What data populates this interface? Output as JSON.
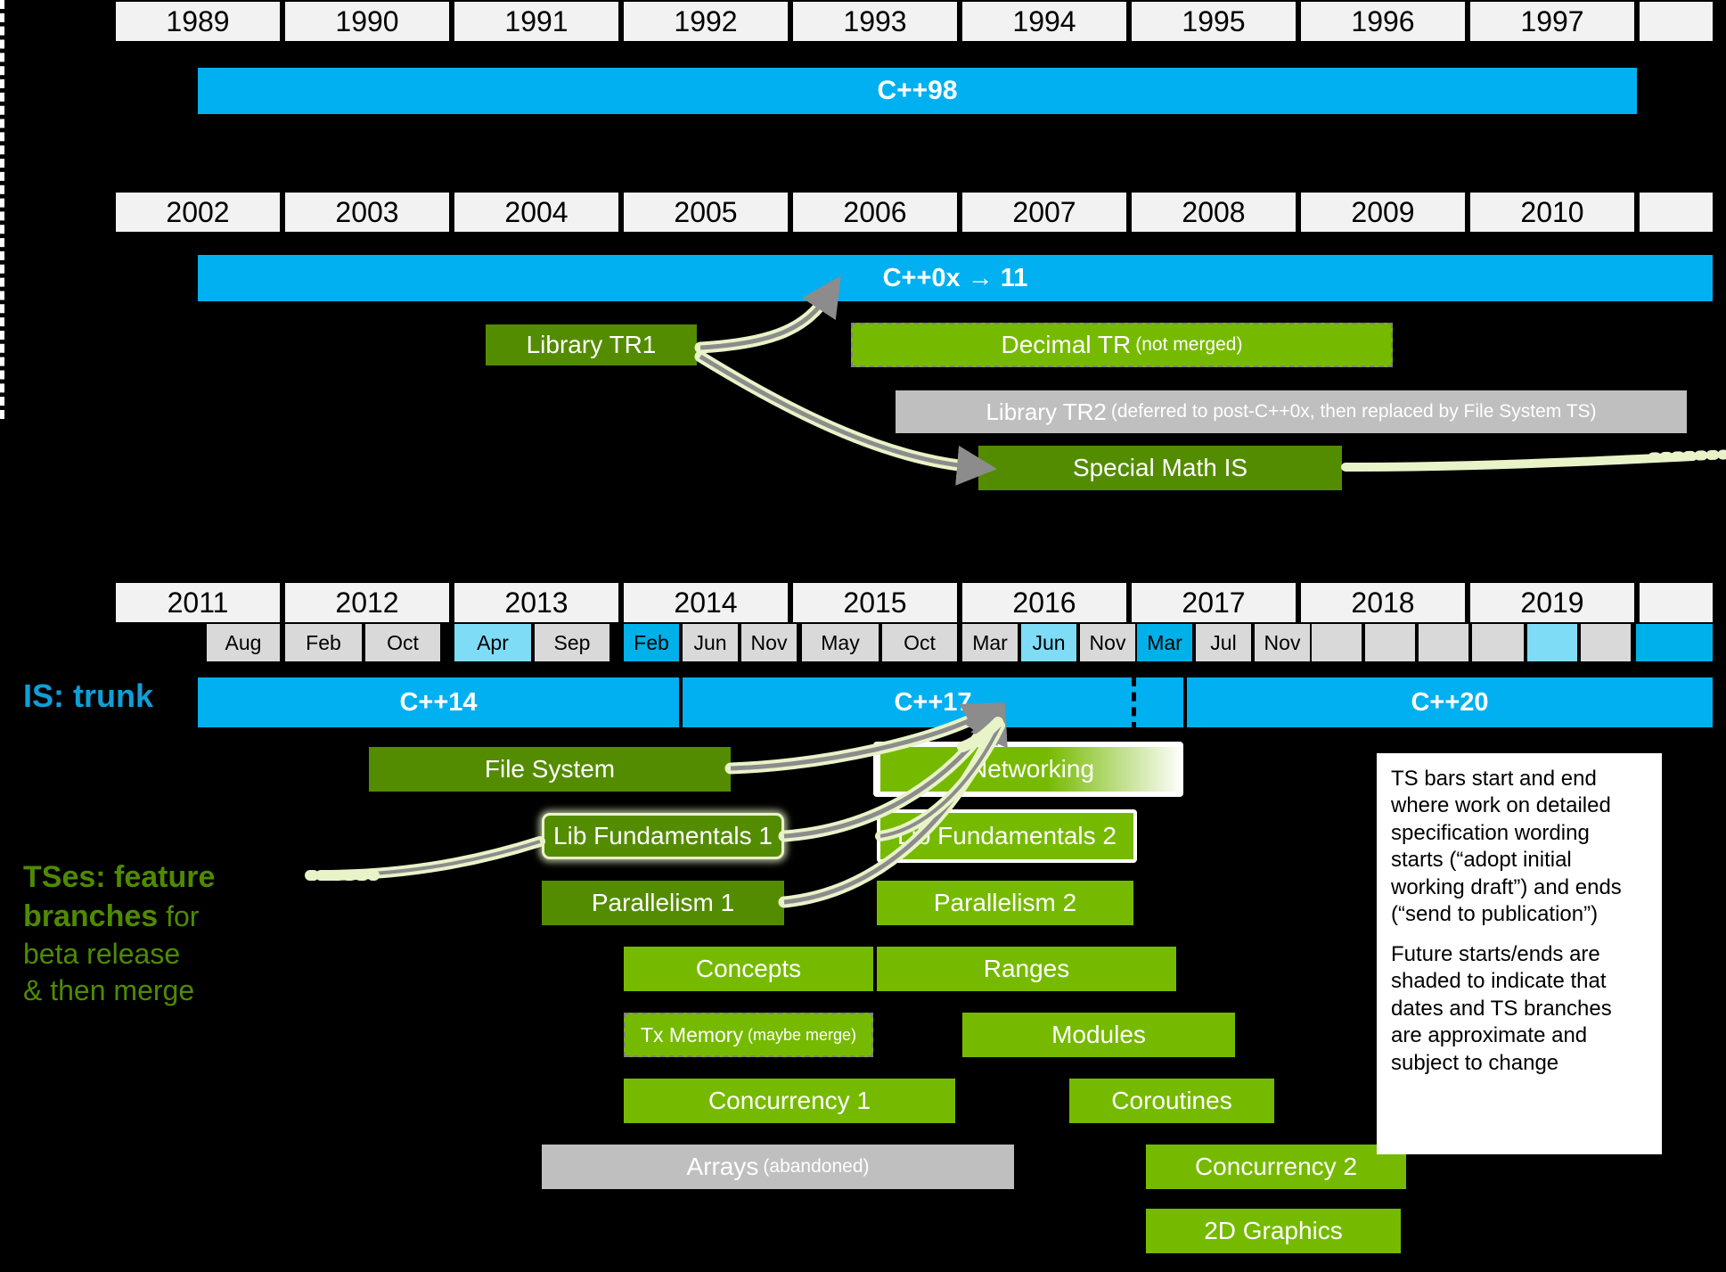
{
  "colors": {
    "background": "#000000",
    "is_bar_blue": "#00b0f0",
    "ts_green": "#76ba00",
    "ts_green_dark": "#548c00",
    "gray_bar": "#bfbfbf",
    "year_cell": "#f2f2f2",
    "month_cell": "#d9d9d9",
    "month_highlight_light": "#7fdcf7",
    "month_highlight": "#00b0e8",
    "label_blue": "#0f9fd8",
    "label_green": "#4f8a00"
  },
  "row1": {
    "years": [
      "1989",
      "1990",
      "1991",
      "1992",
      "1993",
      "1994",
      "1995",
      "1996",
      "1997",
      ""
    ],
    "bars": [
      {
        "label": "C++98"
      }
    ]
  },
  "row2": {
    "years": [
      "2002",
      "2003",
      "2004",
      "2005",
      "2006",
      "2007",
      "2008",
      "2009",
      "2010",
      ""
    ],
    "trunk": {
      "label": "C++0x → 11"
    },
    "bars": [
      {
        "label": "Library TR1",
        "note": ""
      },
      {
        "label": "Decimal TR",
        "note": "(not merged)"
      },
      {
        "label": "Library TR2",
        "note": "(deferred to post-C++0x, then replaced by File System TS)"
      },
      {
        "label": "Special Math IS",
        "note": ""
      }
    ]
  },
  "row3": {
    "years": [
      "2011",
      "2012",
      "2013",
      "2014",
      "2015",
      "2016",
      "2017",
      "2018",
      "2019",
      ""
    ],
    "months": [
      {
        "label": "Aug",
        "state": "normal"
      },
      {
        "label": "Feb",
        "state": "normal"
      },
      {
        "label": "Oct",
        "state": "normal"
      },
      {
        "label": "Apr",
        "state": "lightblue"
      },
      {
        "label": "Sep",
        "state": "normal"
      },
      {
        "label": "Feb",
        "state": "blue"
      },
      {
        "label": "Jun",
        "state": "normal"
      },
      {
        "label": "Nov",
        "state": "normal"
      },
      {
        "label": "May",
        "state": "normal"
      },
      {
        "label": "Oct",
        "state": "normal"
      },
      {
        "label": "Mar",
        "state": "normal"
      },
      {
        "label": "Jun",
        "state": "lightblue"
      },
      {
        "label": "Nov",
        "state": "normal"
      },
      {
        "label": "Mar",
        "state": "blue"
      },
      {
        "label": "Jul",
        "state": "normal"
      },
      {
        "label": "Nov",
        "state": "normal"
      },
      {
        "label": "",
        "state": "normal"
      },
      {
        "label": "",
        "state": "normal"
      },
      {
        "label": "",
        "state": "normal"
      },
      {
        "label": "",
        "state": "lightblue"
      },
      {
        "label": "",
        "state": "normal"
      },
      {
        "label": "",
        "state": "blue"
      }
    ]
  },
  "labels": {
    "is_trunk": "IS: trunk",
    "tses_line1_bold": "TSes: feature",
    "tses_line2_bold": "branches",
    "tses_line2_rest": " for",
    "tses_line3": "beta release",
    "tses_line4": "& then merge"
  },
  "trunk_bars": [
    {
      "label": "C++14"
    },
    {
      "label": "C++17"
    },
    {
      "label": "C++20"
    }
  ],
  "ts_bars": [
    {
      "label": "File System",
      "note": "",
      "style": "green-dark"
    },
    {
      "label": "Networking",
      "note": "",
      "style": "green-fade"
    },
    {
      "label": "Lib Fundamentals 1",
      "note": "",
      "style": "green-dark-glow"
    },
    {
      "label": "Lib Fundamentals 2",
      "note": "",
      "style": "green-halo"
    },
    {
      "label": "Parallelism 1",
      "note": "",
      "style": "green-dark"
    },
    {
      "label": "Parallelism 2",
      "note": "",
      "style": "green"
    },
    {
      "label": "Concepts",
      "note": "",
      "style": "green"
    },
    {
      "label": "Ranges",
      "note": "",
      "style": "green"
    },
    {
      "label": "Tx Memory",
      "note": "(maybe merge)",
      "style": "green-dashed"
    },
    {
      "label": "Modules",
      "note": "",
      "style": "green"
    },
    {
      "label": "Concurrency 1",
      "note": "",
      "style": "green"
    },
    {
      "label": "Coroutines",
      "note": "",
      "style": "green"
    },
    {
      "label": "Arrays",
      "note": "(abandoned)",
      "style": "gray"
    },
    {
      "label": "Concurrency 2",
      "note": "",
      "style": "green"
    },
    {
      "label": "2D Graphics",
      "note": "",
      "style": "green"
    }
  ],
  "infobox": {
    "paragraph1": "TS bars start and end where work on detailed specification wording starts (“adopt initial working draft”) and ends (“send to publication”)",
    "paragraph2": "Future starts/ends are shaded to indicate that dates and TS branches are approximate and subject to change"
  }
}
